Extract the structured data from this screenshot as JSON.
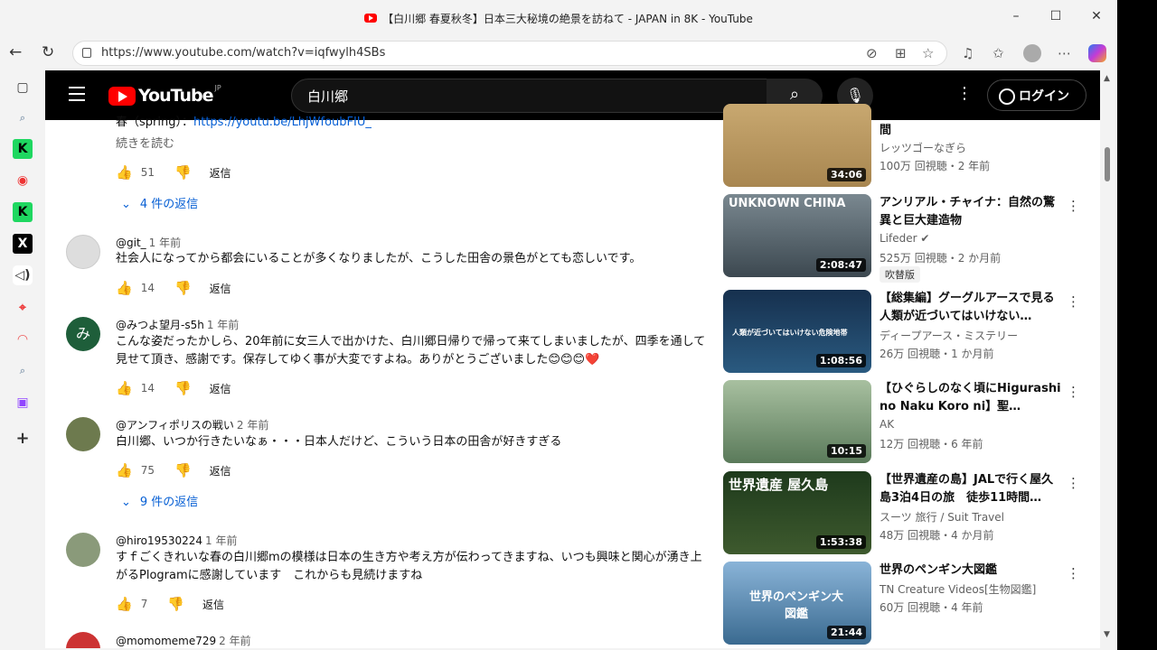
{
  "window": {
    "title": "【白川郷 春夏秋冬】日本三大秘境の絶景を訪ねて - JAPAN in 8K - YouTube",
    "minimize": "–",
    "maximize": "☐",
    "close": "✕"
  },
  "browser": {
    "url": "https://www.youtube.com/watch?v=iqfwylh4SBs",
    "back": "←",
    "refresh": "↻"
  },
  "youtube": {
    "logo": "YouTube",
    "region": "JP",
    "search_value": "白川郷",
    "login": "ログイン"
  },
  "comments": [
    {
      "author": "",
      "time": "",
      "text": "春（spring）：",
      "link": "https://youtu.be/LhjWfoubFIU_",
      "readmore": "続きを読む",
      "likes": "51",
      "reply": "返信",
      "replies": "4 件の返信"
    },
    {
      "author": "@git_",
      "time": "1 年前",
      "text": "社会人になってから都会にいることが多くなりましたが、こうした田舎の景色がとても恋しいです。",
      "likes": "14",
      "reply": "返信"
    },
    {
      "author": "@みつよ望月-s5h",
      "time": "1 年前",
      "avatar_letter": "み",
      "text": "こんな姿だったかしら、20年前に女三人で出かけた、白川郷日帰りで帰って来てしまいましたが、四季を通して見せて頂き、感謝です。保存してゆく事が大変ですよね。ありがとうございました😊😊😊❤️",
      "likes": "14",
      "reply": "返信"
    },
    {
      "author": "@アンフィポリスの戦い",
      "time": "2 年前",
      "text": "白川郷、いつか行きたいなぁ・・・日本人だけど、こういう日本の田舎が好きすぎる",
      "likes": "75",
      "reply": "返信",
      "replies": "9 件の返信"
    },
    {
      "author": "@hiro19530224",
      "time": "1 年前",
      "text": "すｆごくきれいな春の白川郷mの模様は日本の生き方や考え方が伝わってきますね、いつも興味と関心が湧き上がるPlogramに感謝しています　これからも見続けますね",
      "likes": "7",
      "reply": "返信"
    },
    {
      "author": "@momomeme729",
      "time": "2 年前"
    }
  ],
  "videos": [
    {
      "title": "間",
      "channel": "レッツゴーなぎら",
      "meta": "100万 回視聴・2 年前",
      "duration": "34:06",
      "color": "#c9a46a"
    },
    {
      "title": "アンリアル・チャイナ：自然の驚異と巨大建造物",
      "channel": "Lifeder",
      "verified": "✔",
      "meta": "525万 回視聴・2 か月前",
      "duration": "2:08:47",
      "dub": "吹替版",
      "thumb_text": "UNKNOWN CHINA",
      "color": "#5c6870"
    },
    {
      "title": "【総集編】グーグルアースで見る人類が近づいてはいけない…",
      "channel": "ディープアース・ミステリー",
      "meta": "26万 回視聴・1 か月前",
      "duration": "1:08:56",
      "thumb_text": "人類が近づいてはいけない危険地帯",
      "color": "#1e3a5a"
    },
    {
      "title": "【ひぐらしのなく頃にHigurashi no Naku Koro ni】聖…",
      "channel": "AK",
      "meta": "12万 回視聴・6 年前",
      "duration": "10:15",
      "color": "#6a8a6a"
    },
    {
      "title": "【世界遺産の島】JALで行く屋久島3泊4日の旅　徒歩11時間…",
      "channel": "スーツ 旅行 / Suit Travel",
      "meta": "48万 回視聴・4 か月前",
      "duration": "1:53:38",
      "thumb_text": "世界遺産 屋久島",
      "color": "#2f4a2a"
    },
    {
      "title": "世界のペンギン大図鑑",
      "channel": "TN Creature Videos[生物図鑑]",
      "meta": "60万 回視聴・4 年前",
      "duration": "21:44",
      "thumb_text": "世界のペンギン大図鑑",
      "color": "#4a7fa8"
    }
  ]
}
